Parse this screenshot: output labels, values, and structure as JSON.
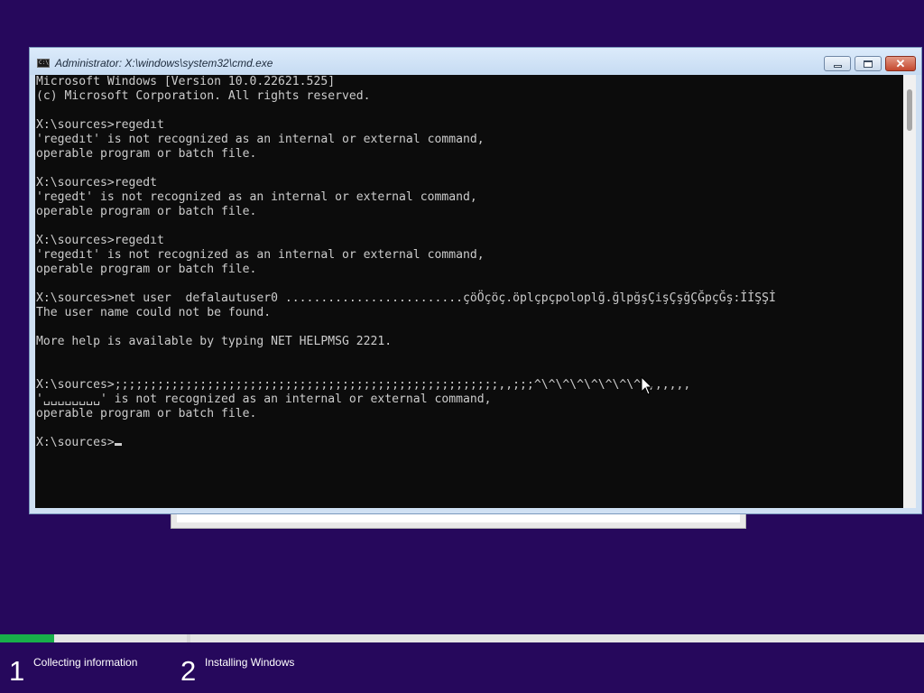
{
  "window": {
    "title": "Administrator: X:\\windows\\system32\\cmd.exe",
    "icon": "cmd-icon",
    "icon_text": "C:\\",
    "controls": {
      "minimize": "minimize-icon",
      "maximize": "maximize-icon",
      "close": "close-icon"
    }
  },
  "terminal": {
    "lines": [
      "Microsoft Windows [Version 10.0.22621.525]",
      "(c) Microsoft Corporation. All rights reserved.",
      "",
      "X:\\sources>regedıt",
      "'regedıt' is not recognized as an internal or external command,",
      "operable program or batch file.",
      "",
      "X:\\sources>regedt",
      "'regedt' is not recognized as an internal or external command,",
      "operable program or batch file.",
      "",
      "X:\\sources>regedıt",
      "'regedıt' is not recognized as an internal or external command,",
      "operable program or batch file.",
      "",
      "X:\\sources>net user  defalautuser0 .........................çöÖçöç.öplçpçpoloplğ.ğlpğşÇişÇşğÇĞpçĞş:İİŞŞİ",
      "The user name could not be found.",
      "",
      "More help is available by typing NET HELPMSG 2221.",
      "",
      "",
      "X:\\sources>;;;;;;;;;;;;;;;;;;;;;;;;;;;;;;;;;;;;;;;;;;;;;;;;;;;;;;,,;;;^\\^\\^\\^\\^\\^\\^\\^,,,,,,,",
      "'␣␣␣␣␣␣␣␣' is not recognized as an internal or external command,",
      "operable program or batch file.",
      "",
      "X:\\sources>"
    ]
  },
  "setup": {
    "progress": 0.29,
    "steps": [
      {
        "number": "1",
        "label": "Collecting information"
      },
      {
        "number": "2",
        "label": "Installing Windows"
      }
    ]
  },
  "colors": {
    "desktop": "#26085c",
    "terminal_bg": "#0c0c0c",
    "terminal_fg": "#cccccc",
    "progress_fill": "#18b04a"
  }
}
